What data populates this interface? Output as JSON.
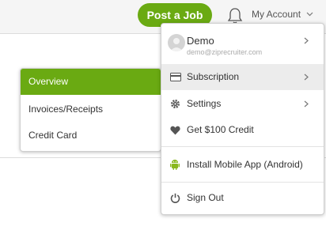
{
  "header": {
    "post_job_label": "Post a Job",
    "account_label": "My Account",
    "brand_color": "#6aaa12"
  },
  "submenu": {
    "items": [
      {
        "label": "Overview",
        "active": true
      },
      {
        "label": "Invoices/Receipts",
        "active": false
      },
      {
        "label": "Credit Card",
        "active": false
      }
    ]
  },
  "account_menu": {
    "user": {
      "name": "Demo",
      "email": "demo@ziprecruiter.com"
    },
    "subscription": {
      "label": "Subscription",
      "icon": "credit-card-icon"
    },
    "settings": {
      "label": "Settings",
      "icon": "gear-icon"
    },
    "credit": {
      "label": "Get $100 Credit",
      "icon": "heart-icon"
    },
    "mobile_app": {
      "label": "Install Mobile App (Android)",
      "icon": "android-icon"
    },
    "sign_out": {
      "label": "Sign Out",
      "icon": "power-icon"
    }
  }
}
